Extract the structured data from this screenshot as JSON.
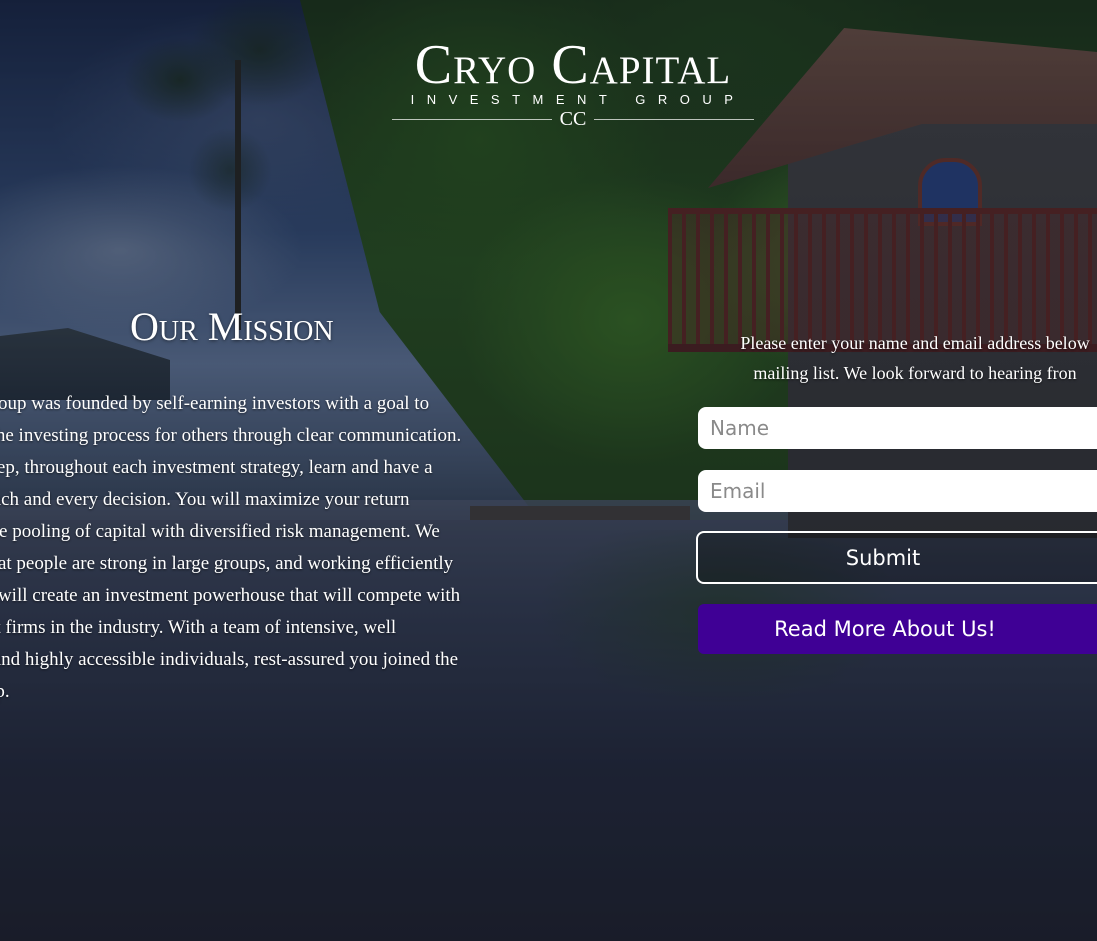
{
  "brand": {
    "title": "Cryo Capital",
    "subtitle": "INVESTMENT GROUP",
    "monogram": "CC"
  },
  "mission": {
    "heading": "Our Mission",
    "lines": [
      "s group was founded by self-earning investors with a goal to",
      "fy the investing process for others through clear communication.",
      "y step, throughout each investment strategy, learn and have a",
      "n each and every decision. You will maximize your return",
      "h the pooling of capital with diversified risk management. We",
      "e that people are strong in large groups, and working efficiently",
      "am will create an investment powerhouse that will compete with",
      "gest firms in the industry. With a team of intensive, well",
      "ed and highly accessible individuals, rest-assured you joined the",
      "roup."
    ]
  },
  "signup": {
    "message_lines": [
      "Please enter your name and email address below",
      "mailing list. We look forward to hearing fron"
    ],
    "name_placeholder": "Name",
    "email_placeholder": "Email",
    "submit_label": "Submit",
    "read_more_label": "Read More About Us!"
  },
  "colors": {
    "read_more_button": "#3f0095",
    "text": "#ffffff"
  }
}
